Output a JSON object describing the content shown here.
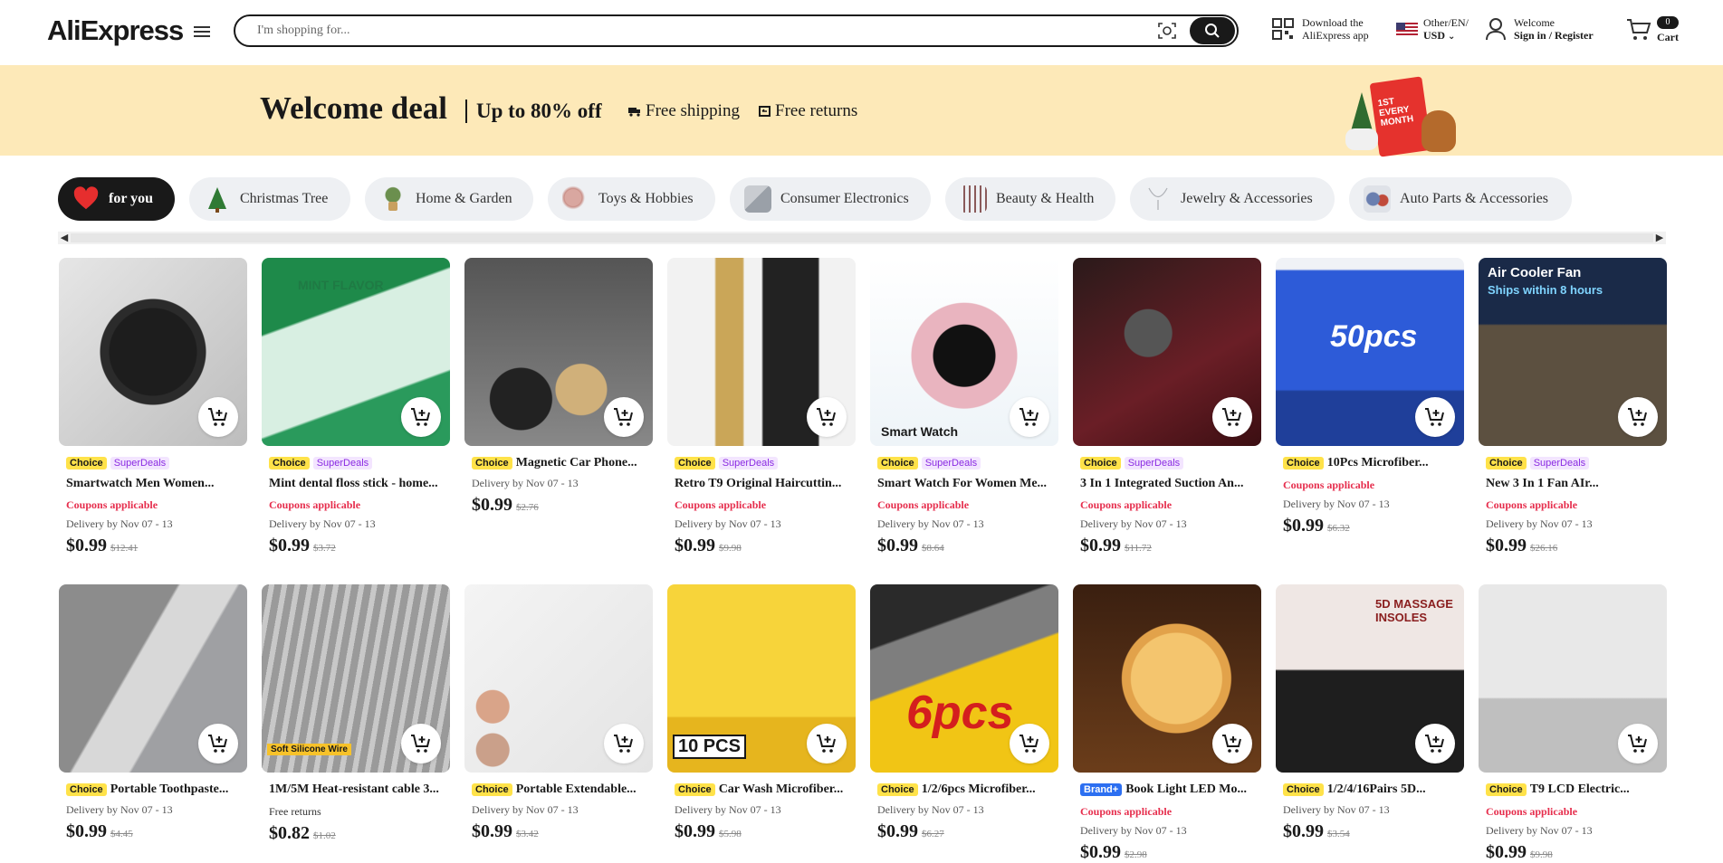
{
  "header": {
    "logo": "AliExpress",
    "search_placeholder": "I'm shopping for...",
    "download_line1": "Download the",
    "download_line2": "AliExpress app",
    "locale_line1": "Other/EN/",
    "locale_line2": "USD",
    "welcome_line1": "Welcome",
    "welcome_line2": "Sign in / Register",
    "cart_label": "Cart",
    "cart_count": "0"
  },
  "banner": {
    "title": "Welcome deal",
    "discount": "Up to 80% off",
    "shipping": "Free shipping",
    "returns": "Free returns",
    "promo_badge": "1ST EVERY MONTH"
  },
  "categories": [
    {
      "label": "for you",
      "icon": "heart-icon",
      "active": true
    },
    {
      "label": "Christmas Tree",
      "icon": "christmas-tree-icon"
    },
    {
      "label": "Home & Garden",
      "icon": "plant-icon"
    },
    {
      "label": "Toys & Hobbies",
      "icon": "toy-icon"
    },
    {
      "label": "Consumer Electronics",
      "icon": "electronics-icon"
    },
    {
      "label": "Beauty & Health",
      "icon": "brushes-icon"
    },
    {
      "label": "Jewelry & Accessories",
      "icon": "necklace-icon"
    },
    {
      "label": "Auto Parts & Accessories",
      "icon": "car-icon"
    }
  ],
  "products": [
    {
      "title": "Smartwatch Men Women...",
      "tags": [
        "Choice",
        "SuperDeals"
      ],
      "coupon": "Coupons applicable",
      "delivery": "Delivery by Nov 07 - 13",
      "price": "$0.99",
      "old_price": "$12.41"
    },
    {
      "title": "Mint dental floss stick - home...",
      "tags": [
        "Choice",
        "SuperDeals"
      ],
      "coupon": "Coupons applicable",
      "delivery": "Delivery by Nov 07 - 13",
      "price": "$0.99",
      "old_price": "$3.72",
      "overlay": "MINT FLAVOR"
    },
    {
      "title": "Magnetic Car Phone...",
      "tags": [
        "Choice"
      ],
      "delivery": "Delivery by Nov 07 - 13",
      "price": "$0.99",
      "old_price": "$2.76"
    },
    {
      "title": "Retro T9 Original Haircuttin...",
      "tags": [
        "Choice",
        "SuperDeals"
      ],
      "coupon": "Coupons applicable",
      "delivery": "Delivery by Nov 07 - 13",
      "price": "$0.99",
      "old_price": "$9.98"
    },
    {
      "title": "Smart Watch For Women Me...",
      "tags": [
        "Choice",
        "SuperDeals"
      ],
      "coupon": "Coupons applicable",
      "delivery": "Delivery by Nov 07 - 13",
      "price": "$0.99",
      "old_price": "$8.64",
      "overlay": "Smart Watch"
    },
    {
      "title": "3 In 1 Integrated Suction An...",
      "tags": [
        "Choice",
        "SuperDeals"
      ],
      "coupon": "Coupons applicable",
      "delivery": "Delivery by Nov 07 - 13",
      "price": "$0.99",
      "old_price": "$11.72"
    },
    {
      "title": "10Pcs Microfiber...",
      "tags": [
        "Choice"
      ],
      "coupon": "Coupons applicable",
      "delivery": "Delivery by Nov 07 - 13",
      "price": "$0.99",
      "old_price": "$6.32",
      "overlay": "50pcs"
    },
    {
      "title": "New 3 In 1 Fan AIr...",
      "tags": [
        "Choice",
        "SuperDeals"
      ],
      "coupon": "Coupons applicable",
      "delivery": "Delivery by Nov 07 - 13",
      "price": "$0.99",
      "old_price": "$26.16",
      "overlay": "Air Cooler Fan",
      "overlay2": "Ships within 8 hours"
    },
    {
      "title": "Portable Toothpaste...",
      "tags": [
        "Choice"
      ],
      "delivery": "Delivery by Nov 07 - 13",
      "price": "$0.99",
      "old_price": "$4.45"
    },
    {
      "title": "1M/5M Heat-resistant cable 3...",
      "tags": [],
      "free_returns": "Free returns",
      "price": "$0.82",
      "old_price": "$1.02",
      "overlay": "Soft Silicone Wire"
    },
    {
      "title": "Portable Extendable...",
      "tags": [
        "Choice"
      ],
      "delivery": "Delivery by Nov 07 - 13",
      "price": "$0.99",
      "old_price": "$3.42"
    },
    {
      "title": "Car Wash Microfiber...",
      "tags": [
        "Choice"
      ],
      "delivery": "Delivery by Nov 07 - 13",
      "price": "$0.99",
      "old_price": "$5.98",
      "overlay": "10 PCS"
    },
    {
      "title": "1/2/6pcs Microfiber...",
      "tags": [
        "Choice"
      ],
      "delivery": "Delivery by Nov 07 - 13",
      "price": "$0.99",
      "old_price": "$6.27",
      "overlay": "6pcs"
    },
    {
      "title": "Book Light LED Mo...",
      "tags": [
        "Brand+"
      ],
      "coupon": "Coupons applicable",
      "delivery": "Delivery by Nov 07 - 13",
      "price": "$0.99",
      "old_price": "$2.98"
    },
    {
      "title": "1/2/4/16Pairs 5D...",
      "tags": [
        "Choice"
      ],
      "delivery": "Delivery by Nov 07 - 13",
      "price": "$0.99",
      "old_price": "$3.54",
      "overlay": "5D MASSAGE INSOLES"
    },
    {
      "title": "T9 LCD Electric...",
      "tags": [
        "Choice"
      ],
      "coupon": "Coupons applicable",
      "delivery": "Delivery by Nov 07 - 13",
      "price": "$0.99",
      "old_price": "$9.98"
    }
  ],
  "colors": {
    "banner_bg": "#fde9b8",
    "coupon_red": "#e62e4d",
    "choice_yellow": "#ffe249",
    "superdeals_purple": "#8a2be2"
  }
}
